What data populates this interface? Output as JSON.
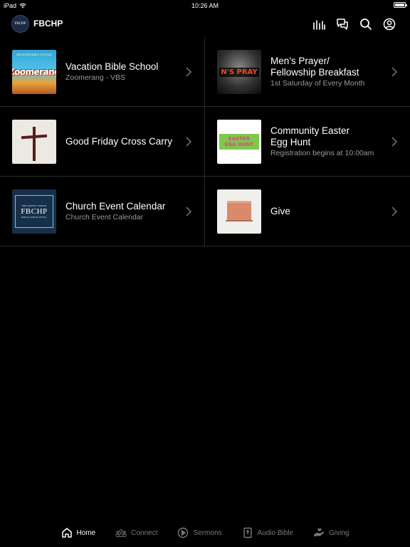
{
  "status_bar": {
    "device": "iPad",
    "time": "10:26 AM",
    "battery_level": 1.0
  },
  "header": {
    "logo_text": "FBCHP",
    "title": "FBCHP"
  },
  "items": [
    {
      "title": "Vacation Bible School",
      "subtitle": "Zoomerang - VBS",
      "thumb": "vbs",
      "thumb_text": "Zoomerang",
      "thumb_top": "VACATION BIBLE SCHOOL"
    },
    {
      "title": "Men's Prayer/\nFellowship Breakfast",
      "subtitle": "1st Saturday of Every Month",
      "thumb": "pray",
      "thumb_text": "N'S PRAY"
    },
    {
      "title": "Good Friday Cross Carry",
      "subtitle": "",
      "thumb": "cross"
    },
    {
      "title": "Community Easter\nEgg Hunt",
      "subtitle": "Registration begins at 10:00am",
      "thumb": "easter",
      "thumb_text_1": "EASTER",
      "thumb_text_2": "EGG HUNT"
    },
    {
      "title": "Church Event Calendar",
      "subtitle": "Church Event Calendar",
      "thumb": "fb",
      "thumb_text_top": "FIRST BAPTIST CHURCH",
      "thumb_text": "FBCHP",
      "thumb_text_bottom": "HERCULANEUM, PEVELY"
    },
    {
      "title": "Give",
      "subtitle": "",
      "thumb": "give"
    }
  ],
  "tabs": [
    {
      "label": "Home",
      "icon": "home-icon",
      "active": true
    },
    {
      "label": "Connect",
      "icon": "people-icon",
      "active": false
    },
    {
      "label": "Sermons",
      "icon": "play-circle-icon",
      "active": false
    },
    {
      "label": "Audio Bible",
      "icon": "bible-icon",
      "active": false
    },
    {
      "label": "Giving",
      "icon": "hand-heart-icon",
      "active": false
    }
  ],
  "colors": {
    "background": "#000000",
    "text": "#ffffff",
    "subtext": "#9a9a9a",
    "divider": "#2a2a2a",
    "tab_inactive": "#7a7a7a"
  }
}
